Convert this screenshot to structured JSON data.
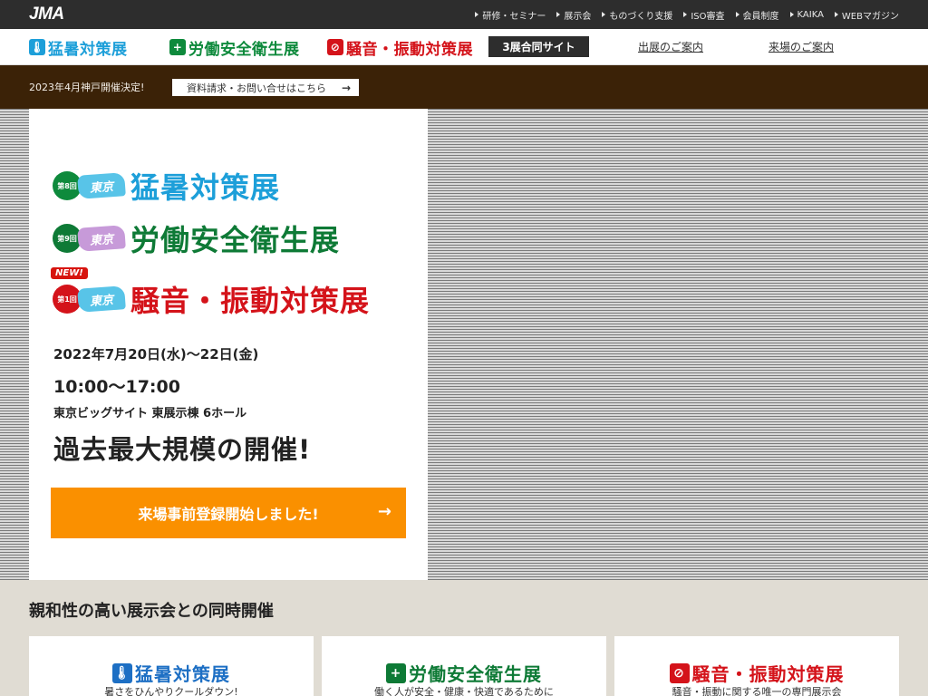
{
  "header": {
    "logo": "JMA",
    "nav": [
      "研修・セミナー",
      "展示会",
      "ものづくり支援",
      "ISO審査",
      "会員制度",
      "KAIKA",
      "WEBマガジン"
    ]
  },
  "titlebar": {
    "shows": [
      {
        "name": "猛暑対策展",
        "color": "#1d9fd9",
        "icon": "thermometer-icon"
      },
      {
        "name": "労働安全衛生展",
        "color": "#0e8a3c",
        "icon": "safety-cross-icon"
      },
      {
        "name": "騒音・振動対策展",
        "color": "#d4131a",
        "icon": "no-noise-icon"
      }
    ],
    "badge": "3展合同サイト",
    "links": [
      "出展のご案内",
      "来場のご案内"
    ]
  },
  "announce": {
    "text": "2023年4月神戸開催決定!",
    "button": "資料請求・お問い合せはこちら"
  },
  "hero": {
    "events": [
      {
        "edition": "第8回",
        "city": "東京",
        "name": "猛暑対策展",
        "color": "#1d9fd9",
        "circle": "#0e8a3c"
      },
      {
        "edition": "第9回",
        "city": "東京",
        "name": "労働安全衛生展",
        "color": "#0e7a36",
        "circle": "#0e7a36"
      },
      {
        "edition": "第1回",
        "city": "東京",
        "name": "騒音・振動対策展",
        "color": "#d4131a",
        "circle": "#d4131a"
      }
    ],
    "new_tag": "NEW!",
    "date": "2022年7月20日(水)〜22日(金)",
    "time": "10:00〜17:00",
    "venue": "東京ビッグサイト 東展示棟 6ホール",
    "scale": "過去最大規模の開催!",
    "register": "来場事前登録開始しました!"
  },
  "colocated": {
    "heading": "親和性の高い展示会との同時開催",
    "cards": [
      {
        "name": "猛暑対策展",
        "desc": "暑さをひんやりクールダウン!",
        "color": "#1d6fc4",
        "icon": "thermometer-icon"
      },
      {
        "name": "労働安全衛生展",
        "desc": "働く人が安全・健康・快適であるために",
        "color": "#0e7a36",
        "icon": "safety-cross-icon"
      },
      {
        "name": "騒音・振動対策展",
        "desc": "騒音・振動に関する唯一の専門展示会",
        "color": "#d4131a",
        "icon": "no-noise-icon"
      }
    ]
  }
}
